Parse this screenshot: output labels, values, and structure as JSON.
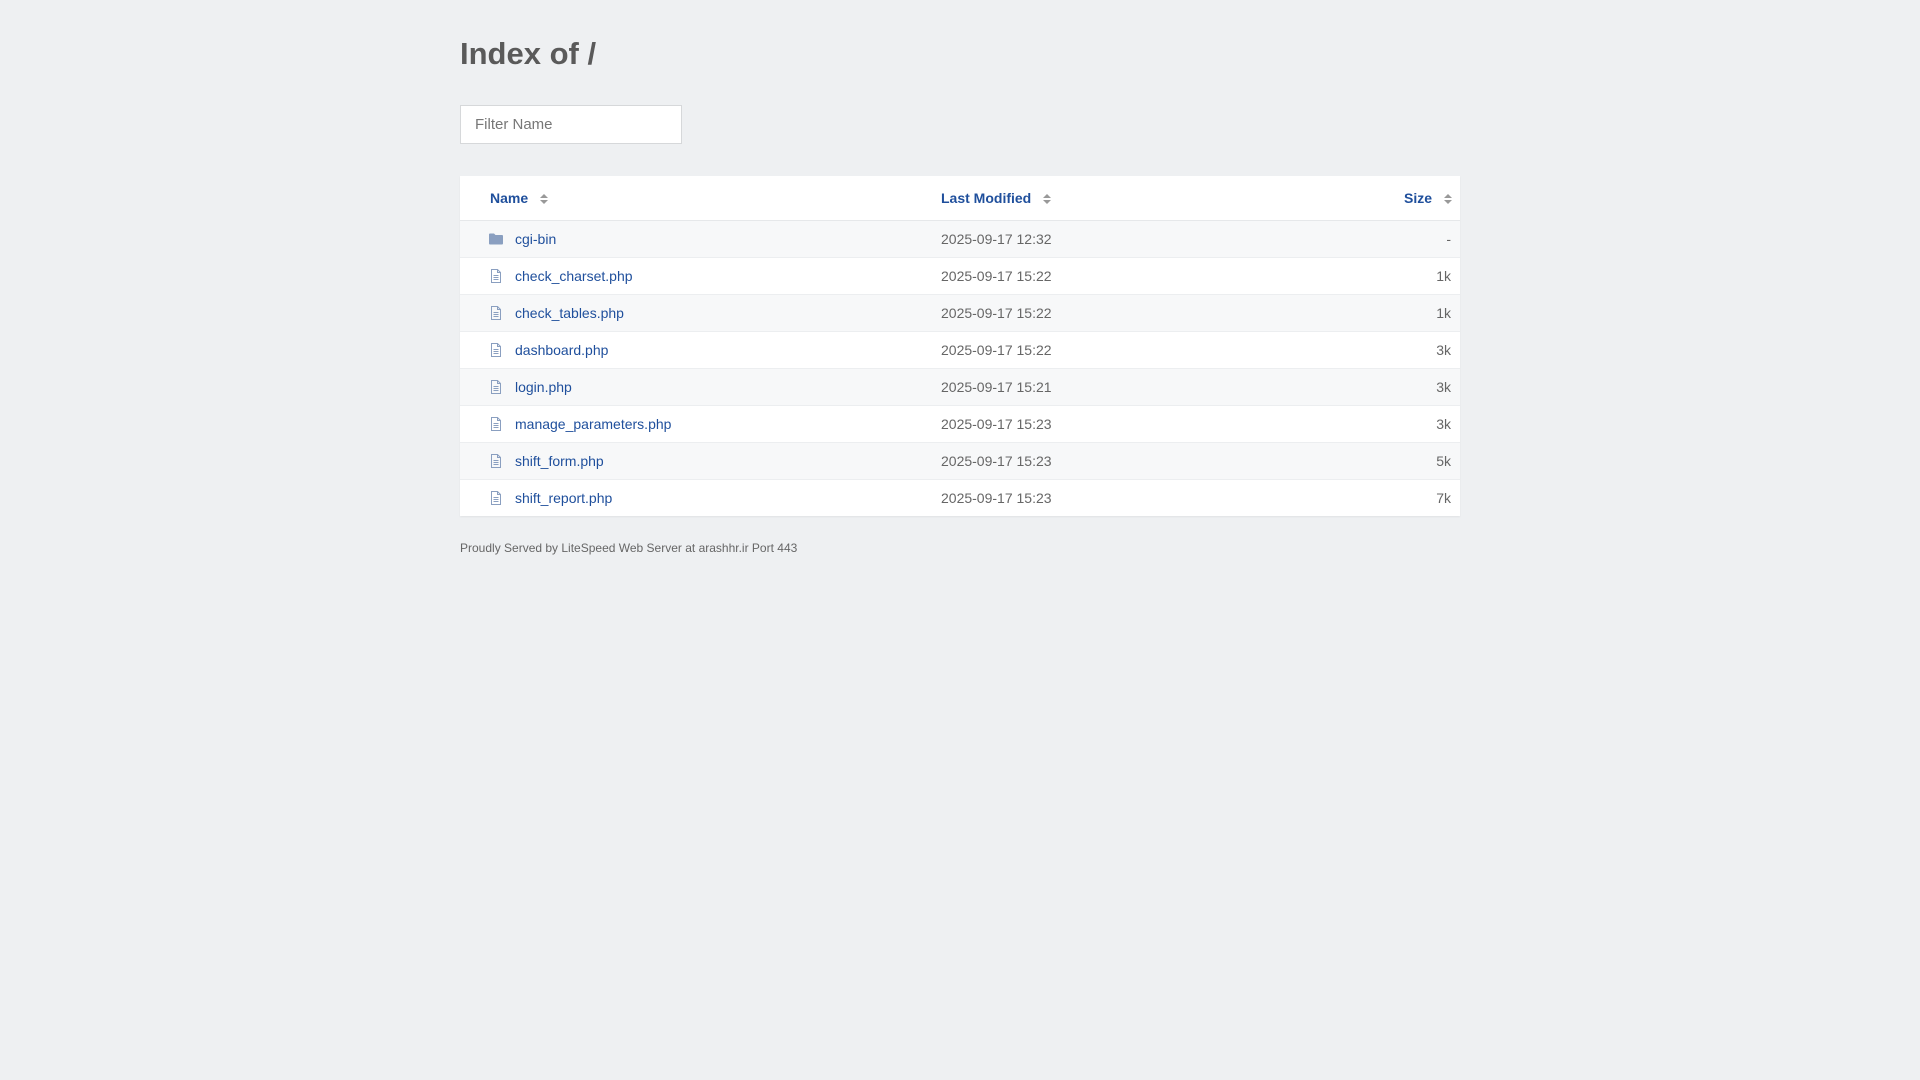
{
  "page": {
    "title": "Index of /",
    "filter_placeholder": "Filter Name",
    "footer": "Proudly Served by LiteSpeed Web Server at arashhr.ir Port 443"
  },
  "table": {
    "headers": {
      "name": "Name",
      "last_modified": "Last Modified",
      "size": "Size"
    },
    "rows": [
      {
        "icon": "folder-icon",
        "name": "cgi-bin",
        "modified": "2025-09-17 12:32",
        "size": "-"
      },
      {
        "icon": "file-icon",
        "name": "check_charset.php",
        "modified": "2025-09-17 15:22",
        "size": "1k"
      },
      {
        "icon": "file-icon",
        "name": "check_tables.php",
        "modified": "2025-09-17 15:22",
        "size": "1k"
      },
      {
        "icon": "file-icon",
        "name": "dashboard.php",
        "modified": "2025-09-17 15:22",
        "size": "3k"
      },
      {
        "icon": "file-icon",
        "name": "login.php",
        "modified": "2025-09-17 15:21",
        "size": "3k"
      },
      {
        "icon": "file-icon",
        "name": "manage_parameters.php",
        "modified": "2025-09-17 15:23",
        "size": "3k"
      },
      {
        "icon": "file-icon",
        "name": "shift_form.php",
        "modified": "2025-09-17 15:23",
        "size": "5k"
      },
      {
        "icon": "file-icon",
        "name": "shift_report.php",
        "modified": "2025-09-17 15:23",
        "size": "7k"
      }
    ]
  },
  "colors": {
    "background": "#eef0f2",
    "link": "#1f4f9c",
    "icon": "#8a9fc0"
  }
}
